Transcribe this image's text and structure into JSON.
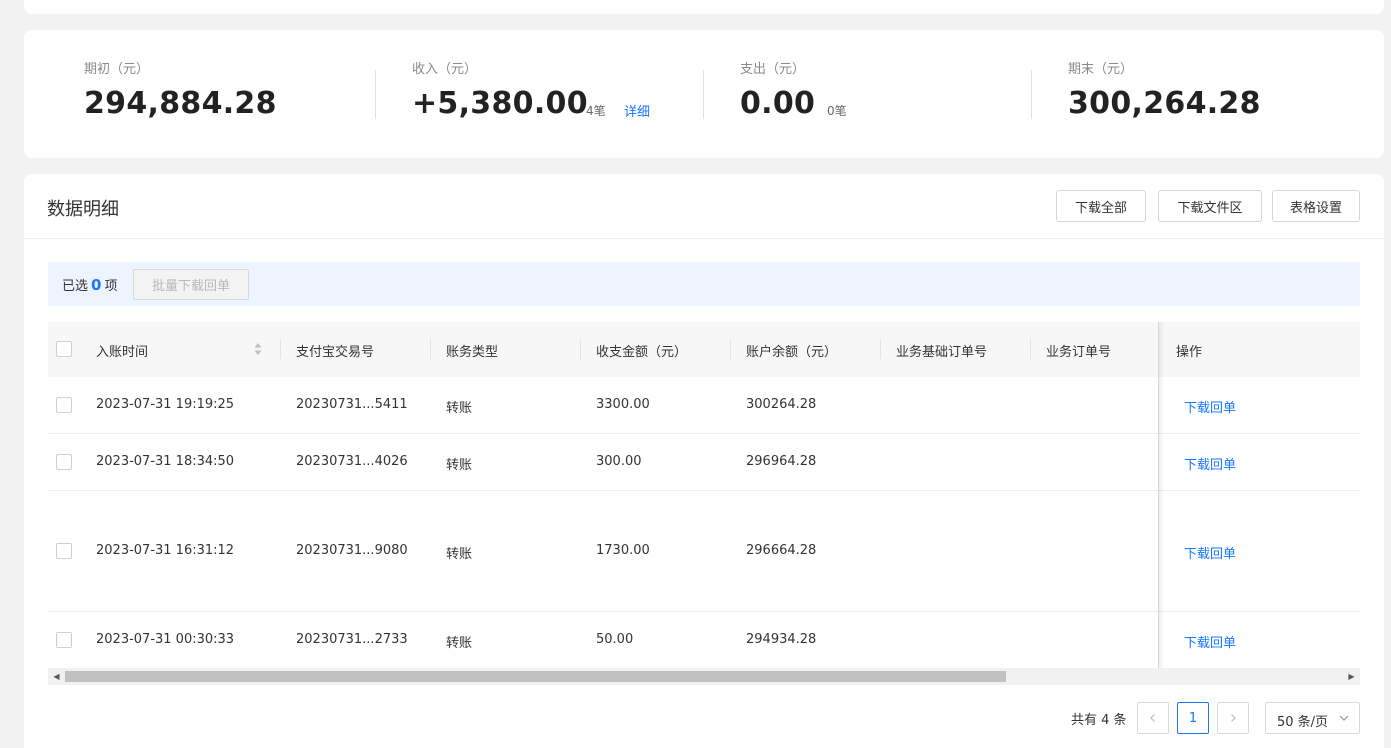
{
  "summary": {
    "opening": {
      "label": "期初（元）",
      "value": "294,884.28"
    },
    "income": {
      "label": "收入（元）",
      "value": "+5,380.00",
      "count": "4笔",
      "detail": "详细"
    },
    "expense": {
      "label": "支出（元）",
      "value": "0.00",
      "count": "0笔"
    },
    "closing": {
      "label": "期末（元）",
      "value": "300,264.28"
    }
  },
  "detail": {
    "title": "数据明细",
    "buttons": {
      "download_all": "下载全部",
      "download_area": "下载文件区",
      "table_settings": "表格设置"
    }
  },
  "selection": {
    "prefix": "已选",
    "count": "0",
    "suffix": "项",
    "batch_button": "批量下载回单"
  },
  "table": {
    "columns": [
      "入账时间",
      "支付宝交易号",
      "账务类型",
      "收支金额（元）",
      "账户余额（元）",
      "业务基础订单号",
      "业务订单号",
      "操作"
    ],
    "rows": [
      {
        "time": "2023-07-31 19:19:25",
        "trade_no": "20230731...5411",
        "type": "转账",
        "amount": "3300.00",
        "balance": "300264.28",
        "action": "下载回单"
      },
      {
        "time": "2023-07-31 18:34:50",
        "trade_no": "20230731...4026",
        "type": "转账",
        "amount": "300.00",
        "balance": "296964.28",
        "action": "下载回单"
      },
      {
        "time": "2023-07-31 16:31:12",
        "trade_no": "20230731...9080",
        "type": "转账",
        "amount": "1730.00",
        "balance": "296664.28",
        "action": "下载回单"
      },
      {
        "time": "2023-07-31 00:30:33",
        "trade_no": "20230731...2733",
        "type": "转账",
        "amount": "50.00",
        "balance": "294934.28",
        "action": "下载回单"
      }
    ]
  },
  "pagination": {
    "total": "共有 4 条",
    "current_page": "1",
    "page_size": "50 条/页"
  },
  "icons": {
    "sort": "sort-icon",
    "prev": "chevron-left-icon",
    "next": "chevron-right-icon",
    "dropdown": "chevron-down-icon"
  },
  "colors": {
    "accent": "#1677ff",
    "selection_bg": "#edf4ff"
  }
}
